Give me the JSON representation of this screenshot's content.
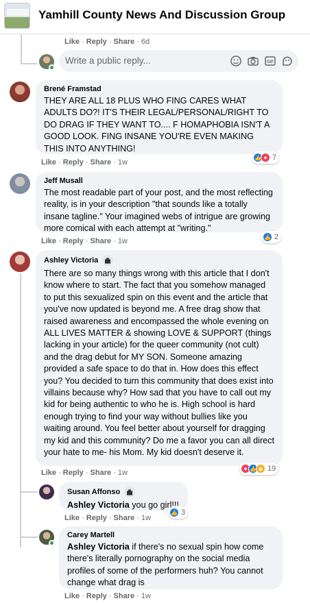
{
  "header": {
    "group_name": "Yamhill County News And Discussion Group"
  },
  "prior_actions": {
    "like": "Like",
    "reply": "Reply",
    "share": "Share",
    "time": "6d"
  },
  "reply_input": {
    "placeholder": "Write a public reply..."
  },
  "comments": [
    {
      "author": "Brené Framstad",
      "text": "THEY ARE ALL 18 PLUS WHO FING CARES WHAT ADULTS DO?! IT'S THEIR LEGAL/PERSONAL/RIGHT TO DO DRAG IF THEY WANT TO.... F HOMAPHOBIA ISN'T A GOOD LOOK. FING INSANE YOU'RE EVEN MAKING THIS INTO ANYTHING!",
      "actions": {
        "like": "Like",
        "reply": "Reply",
        "share": "Share",
        "time": "1w"
      },
      "reaction_count": "7"
    },
    {
      "author": "Jeff Musall",
      "text": "The most readable part of your post, and the most reflecting reality, is in your description \"that sounds like a totally insane tagline.\" Your imagined webs of intrigue are growing more comical with each attempt at \"writing.\"",
      "actions": {
        "like": "Like",
        "reply": "Reply",
        "share": "Share",
        "time": "1w"
      },
      "reaction_count": "2"
    },
    {
      "author": "Ashley Victoria",
      "text": "There are so many things wrong with this article that I don't know where to start. The fact that you somehow managed to put this sexualized spin on this event and the article that you've now updated is beyond me. A free drag show that raised awareness and encompassed the whole evening on ALL LIVES MATTER & showing LOVE & SUPPORT (things lacking in your article) for the queer community (not cult) and the drag debut for MY SON. Someone amazing provided a safe space to do that in. How does this effect you? You decided to turn this community that does exist into villains because why? How sad that you have to call out my kid for being authentic to who he is. High school is hard enough trying to find your way without bullies like you waiting around. You feel better about yourself for dragging my kid and this community? Do me a favor you can all direct your hate to me- his Mom. My kid doesn't deserve it.",
      "actions": {
        "like": "Like",
        "reply": "Reply",
        "share": "Share",
        "time": "1w"
      },
      "reaction_count": "19"
    }
  ],
  "replies": [
    {
      "author": "Susan Affonso",
      "tag": "Ashley Victoria",
      "text": " you go girl!!!",
      "actions": {
        "like": "Like",
        "reply": "Reply",
        "share": "Share",
        "time": "1w"
      },
      "reaction_count": "3"
    },
    {
      "author": "Carey Martell",
      "tag": "Ashley Victoria",
      "text": " if there's no sexual spin how come there's literally pornography on the social media profiles of some of the performers huh? You cannot change what drag is",
      "actions": {
        "like": "Like",
        "reply": "Reply",
        "share": "Share",
        "time": "1w"
      }
    }
  ],
  "colors": {
    "bubble": "#f0f2f5",
    "meta": "#65676b",
    "like_blue": "#1877f2",
    "love_red": "#f33e58",
    "online_green": "#31a24c"
  },
  "icons": [
    "group-thumbnail",
    "emoji-icon",
    "camera-icon",
    "gif-icon",
    "sticker-icon",
    "top-fan-badge-icon",
    "like-reaction-icon",
    "love-reaction-icon",
    "haha-reaction-icon"
  ]
}
